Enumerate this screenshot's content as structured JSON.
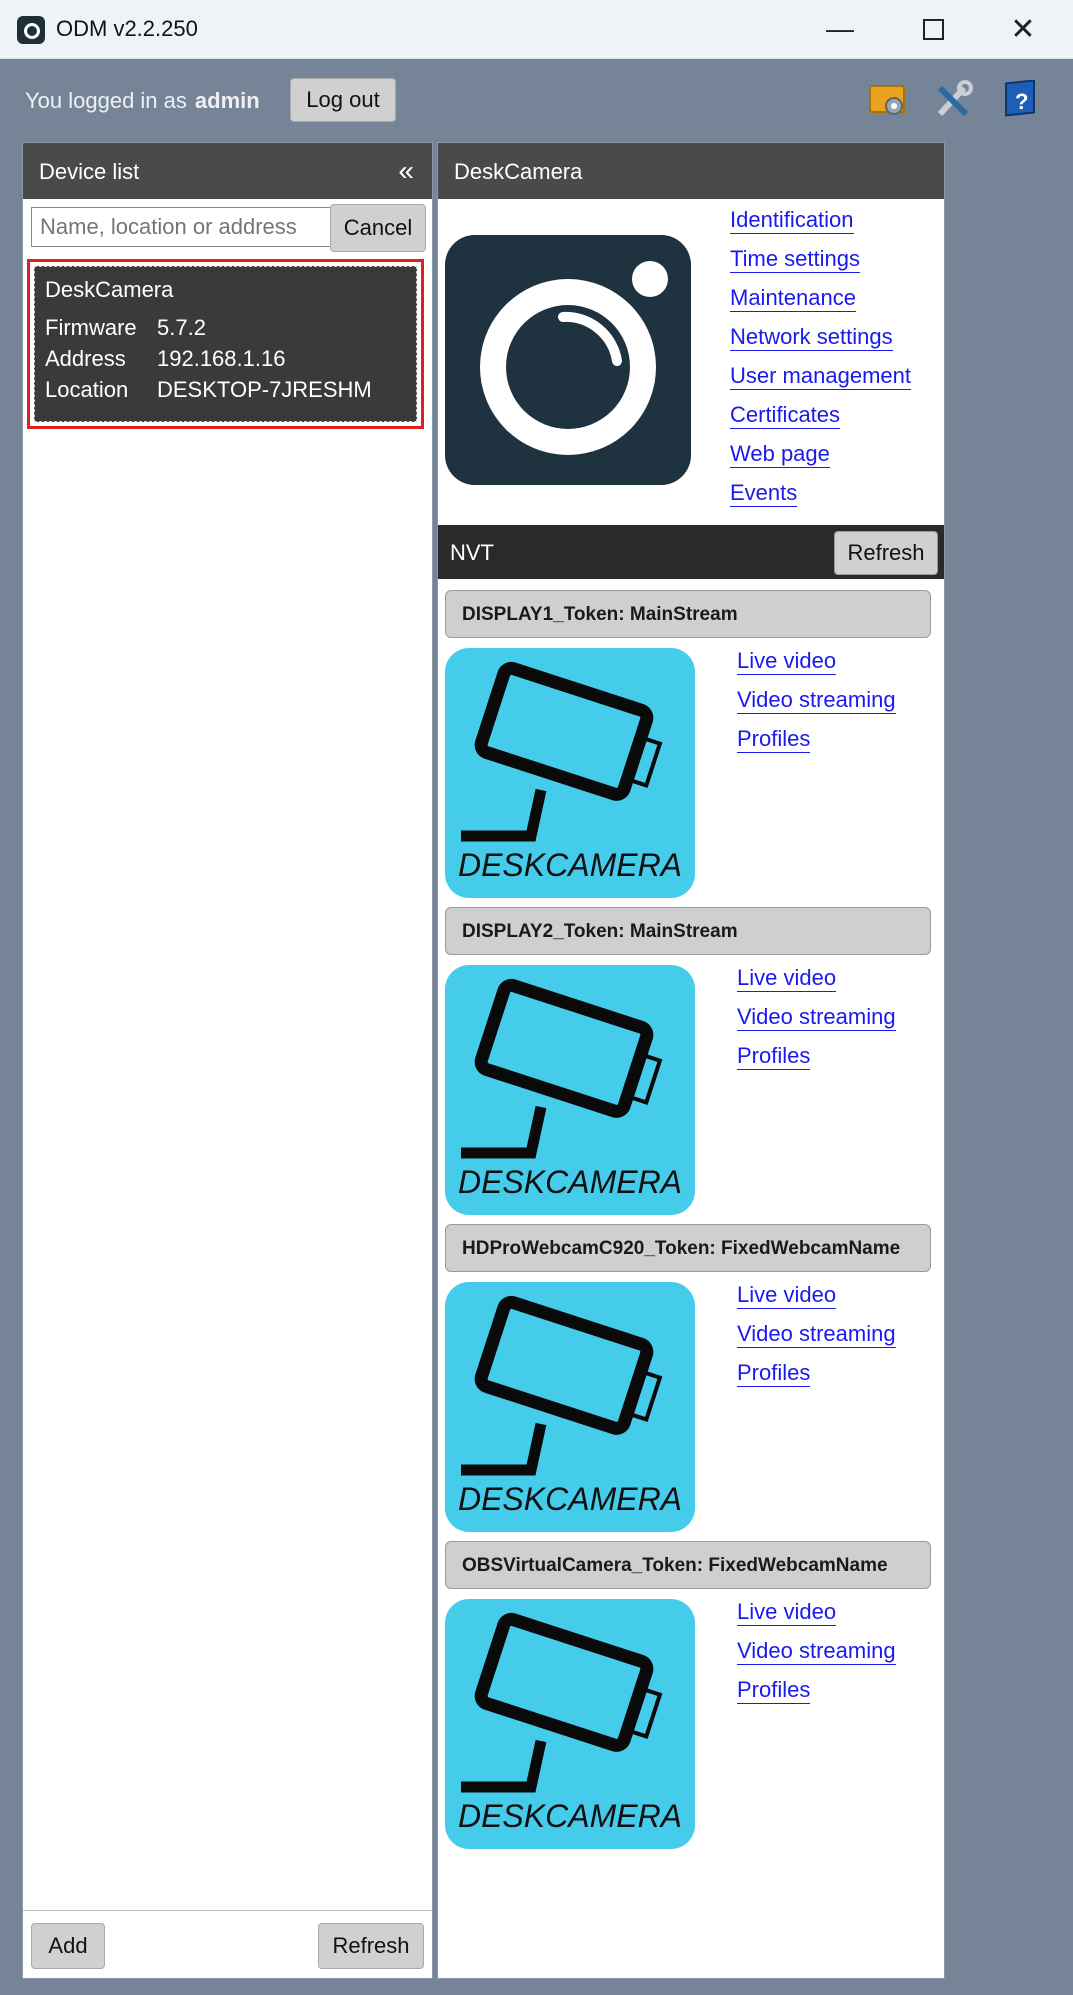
{
  "window": {
    "title": "ODM v2.2.250"
  },
  "session": {
    "prefix": "You logged in as",
    "user": "admin",
    "logout_label": "Log out"
  },
  "left_panel": {
    "title": "Device list",
    "search_placeholder": "Name, location or address",
    "cancel_label": "Cancel",
    "device": {
      "name": "DeskCamera",
      "rows": [
        {
          "key": "Firmware",
          "value": "5.7.2"
        },
        {
          "key": "Address",
          "value": "192.168.1.16"
        },
        {
          "key": "Location",
          "value": "DESKTOP-7JRESHM"
        }
      ]
    },
    "add_label": "Add",
    "refresh_label": "Refresh"
  },
  "right_panel": {
    "title": "DeskCamera",
    "links": [
      "Identification",
      "Time settings",
      "Maintenance",
      "Network settings",
      "User management",
      "Certificates",
      "Web page",
      "Events"
    ],
    "nvt": {
      "title": "NVT",
      "refresh_label": "Refresh"
    },
    "profiles": [
      {
        "name": "DISPLAY1_Token: MainStream",
        "tile_text": "DESKCAMERA",
        "links": [
          "Live video",
          "Video streaming",
          "Profiles"
        ]
      },
      {
        "name": "DISPLAY2_Token: MainStream",
        "tile_text": "DESKCAMERA",
        "links": [
          "Live video",
          "Video streaming",
          "Profiles"
        ]
      },
      {
        "name": "HDProWebcamC920_Token: FixedWebcamName",
        "tile_text": "DESKCAMERA",
        "links": [
          "Live video",
          "Video streaming",
          "Profiles"
        ]
      },
      {
        "name": "OBSVirtualCamera_Token: FixedWebcamName",
        "tile_text": "DESKCAMERA",
        "links": [
          "Live video",
          "Video streaming",
          "Profiles"
        ]
      }
    ]
  },
  "colors": {
    "accent_link": "#1a1aee",
    "selection_border": "#e02020",
    "tile_bg": "#46cceb",
    "window_bg": "#758597"
  }
}
